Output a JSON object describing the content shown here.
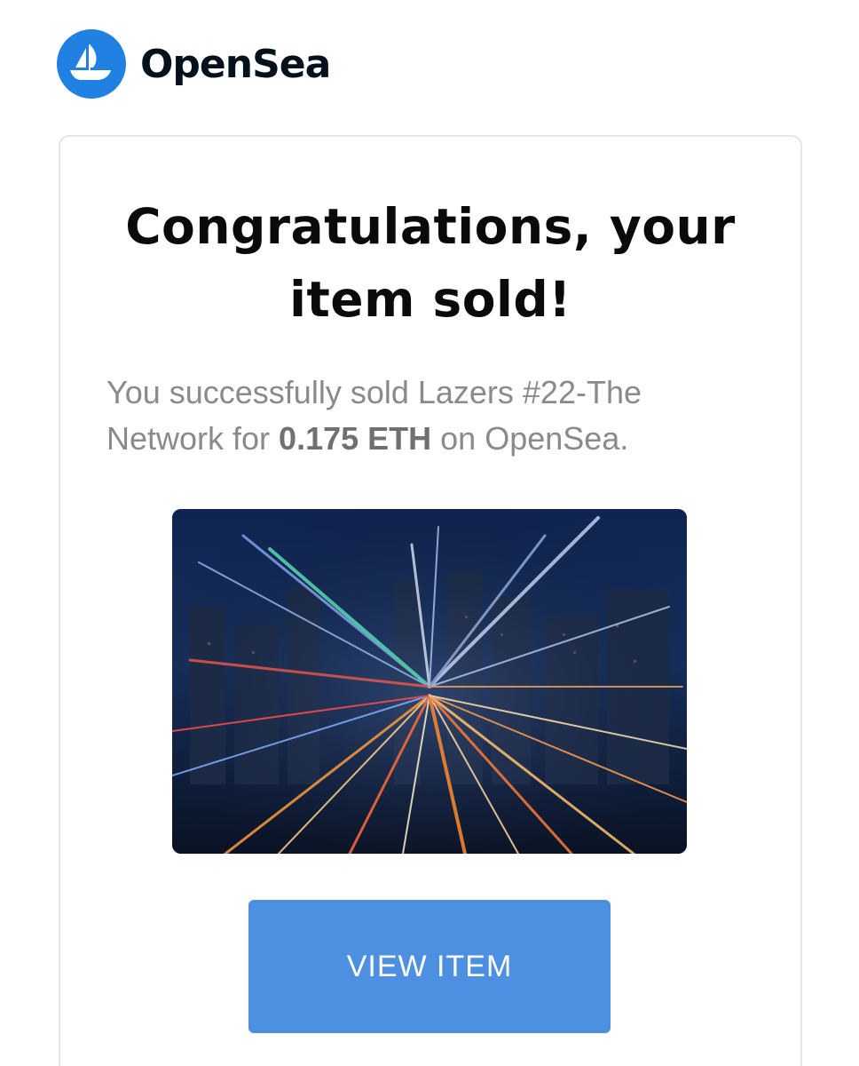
{
  "brand": {
    "name": "OpenSea",
    "logo_icon": "opensea-ship-icon",
    "logo_color": "#2081e2"
  },
  "email": {
    "heading": "Congratulations, your item sold!",
    "message_prefix": "You successfully sold Lazers #22-The Network for ",
    "price": "0.175 ETH",
    "message_suffix": " on OpenSea.",
    "image_alt": "Lazers #22-The Network",
    "button_label": "VIEW ITEM",
    "button_color": "#4d8fe1"
  }
}
